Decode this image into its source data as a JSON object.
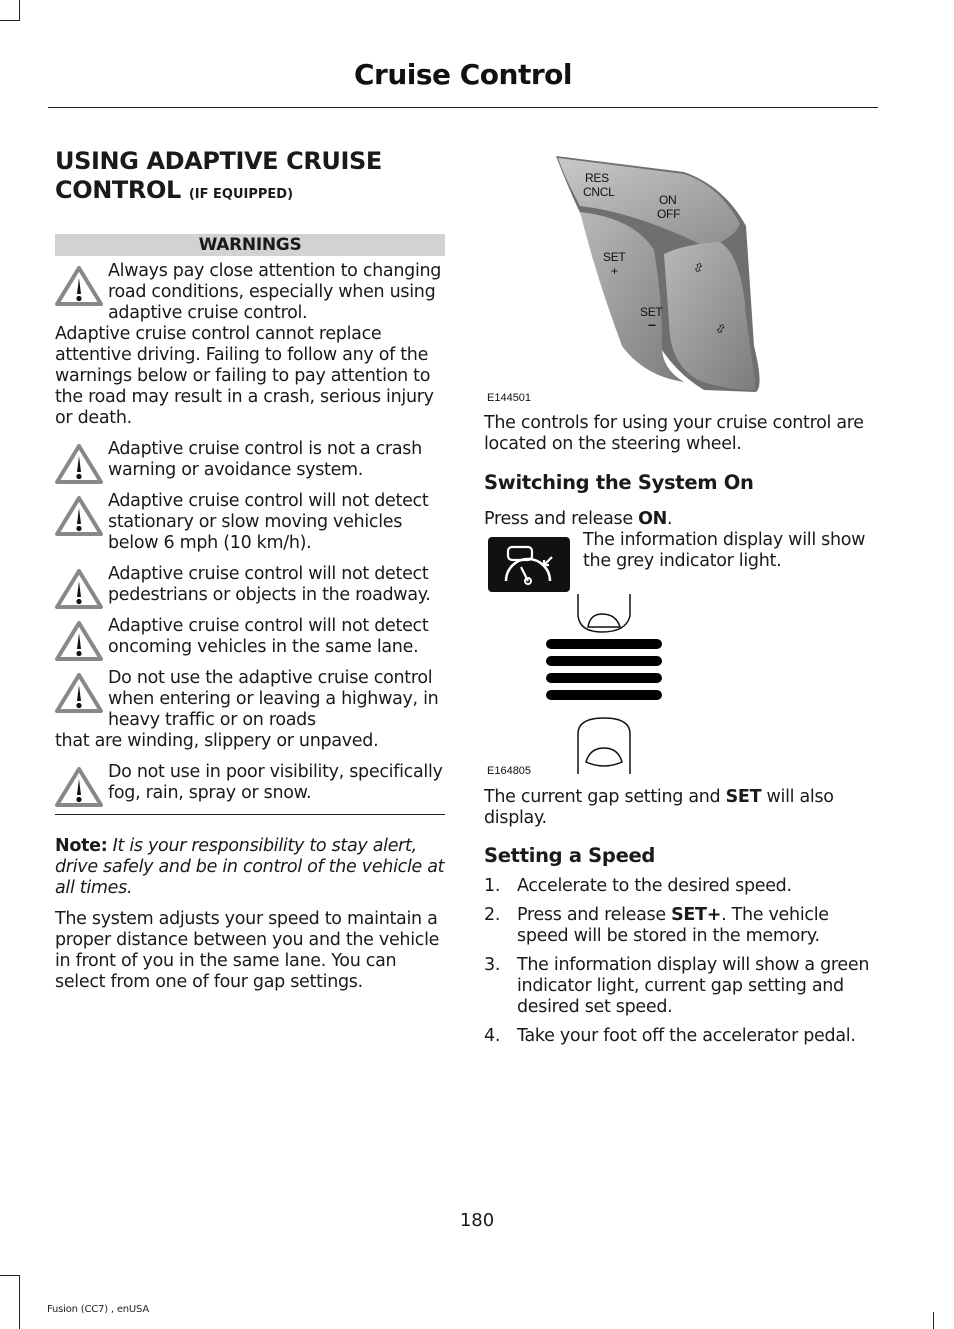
{
  "header": {
    "title": "Cruise Control"
  },
  "left_column": {
    "heading": "USING ADAPTIVE CRUISE",
    "heading_line2": "CONTROL",
    "heading_qualifier": "(IF EQUIPPED)",
    "warnings_label": "WARNINGS",
    "warnings": [
      {
        "icon": "warning-triangle-icon",
        "first_lines": "Always pay close attention to changing road conditions, especially when using adaptive cruise control.",
        "continuation": "Adaptive cruise control cannot replace attentive driving. Failing to follow any of the warnings below or failing to pay attention to the road may result in a crash, serious injury or death."
      },
      {
        "icon": "warning-triangle-icon",
        "first_lines": "Adaptive cruise control is not a crash warning or avoidance system.",
        "continuation": ""
      },
      {
        "icon": "warning-triangle-icon",
        "first_lines": "Adaptive cruise control will not detect stationary or slow moving vehicles below 6 mph (10 km/h).",
        "continuation": ""
      },
      {
        "icon": "warning-triangle-icon",
        "first_lines": "Adaptive cruise control will not detect pedestrians or objects in the roadway.",
        "continuation": ""
      },
      {
        "icon": "warning-triangle-icon",
        "first_lines": "Adaptive cruise control will not detect oncoming vehicles in the same lane.",
        "continuation": ""
      },
      {
        "icon": "warning-triangle-icon",
        "first_lines": "Do not use the adaptive cruise control when entering or leaving a highway, in heavy traffic or on roads",
        "continuation": "that are winding, slippery or unpaved."
      },
      {
        "icon": "warning-triangle-icon",
        "first_lines": "Do not use in poor visibility, specifically fog, rain, spray or snow.",
        "continuation": ""
      }
    ],
    "note_label": "Note:",
    "note_text": "It is your responsibility to stay alert, drive safely and be in control of the vehicle at all times.",
    "paragraph": "The system adjusts your speed to maintain a proper distance between you and the vehicle in front of you in the same lane. You can select from one of four gap settings."
  },
  "right_column": {
    "figure1": {
      "id": "E144501",
      "buttons": {
        "res": "RES",
        "cncl": "CNCL",
        "on": "ON",
        "off": "OFF",
        "set_plus": "SET",
        "plus": "+",
        "set_minus": "SET",
        "minus": "–"
      }
    },
    "controls_text": "The controls for using your cruise control are located on the steering wheel.",
    "section1_heading": "Switching the System On",
    "press_prefix": "Press and release ",
    "press_bold": "ON",
    "press_suffix": ".",
    "indicator_text": "The information display will show the grey indicator light.",
    "figure2": {
      "id": "E164805",
      "gap_bars": 4
    },
    "gap_prefix": "The current gap setting and ",
    "gap_bold": "SET",
    "gap_suffix": " will also display.",
    "section2_heading": "Setting a Speed",
    "steps": [
      {
        "num": "1.",
        "pre": "Accelerate to the desired speed.",
        "bold": "",
        "post": ""
      },
      {
        "num": "2.",
        "pre": "Press and release ",
        "bold": "SET+",
        "post": ". The vehicle speed will be stored in the memory."
      },
      {
        "num": "3.",
        "pre": "The information display will show a green indicator light, current gap setting and desired set speed.",
        "bold": "",
        "post": ""
      },
      {
        "num": "4.",
        "pre": "Take your foot off the accelerator pedal.",
        "bold": "",
        "post": ""
      }
    ]
  },
  "page_number": "180",
  "footer": "Fusion (CC7) , enUSA"
}
